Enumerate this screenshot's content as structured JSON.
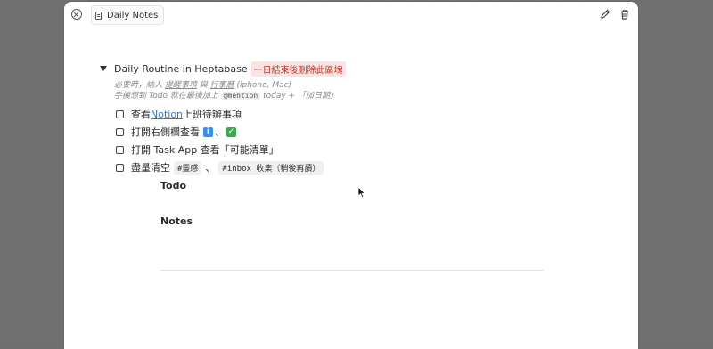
{
  "window": {
    "tab_title": "Daily Notes",
    "icons": [
      "close-icon",
      "document-icon",
      "pencil-icon",
      "trash-icon"
    ]
  },
  "block": {
    "title": "Daily Routine in Heptabase",
    "tag": "一日結束後刪除此區塊",
    "meta_line1_a": "必要時，納入 ",
    "meta_line1_link1": "提醒事項",
    "meta_line1_b": " 與 ",
    "meta_line1_link2": "行事曆",
    "meta_line1_c": " (iphone, Mac)",
    "meta_line2_a": "手機想到 Todo 就在最後加上 ",
    "meta_line2_code": "@mention",
    "meta_line2_b": " today + 「加日期」"
  },
  "tasks": [
    {
      "pre": "查看 ",
      "link": "Notion",
      "post": " 上班待辦事項"
    },
    {
      "pre": "打開右側欄查看 ",
      "sep": "、"
    },
    {
      "pre": "打開 Task App 查看「可能清單」"
    },
    {
      "pre": "盡量清空 ",
      "tag1": "#靈感",
      "sep": "、",
      "tag2": "#inbox 收集（稍後再讀）"
    }
  ],
  "sections": {
    "todo": "Todo",
    "notes": "Notes"
  },
  "colors": {
    "accent_link": "#2f77c7",
    "tag_red_bg": "#f8e4e3",
    "tag_red_text": "#c0392b",
    "backdrop": "#707070"
  }
}
